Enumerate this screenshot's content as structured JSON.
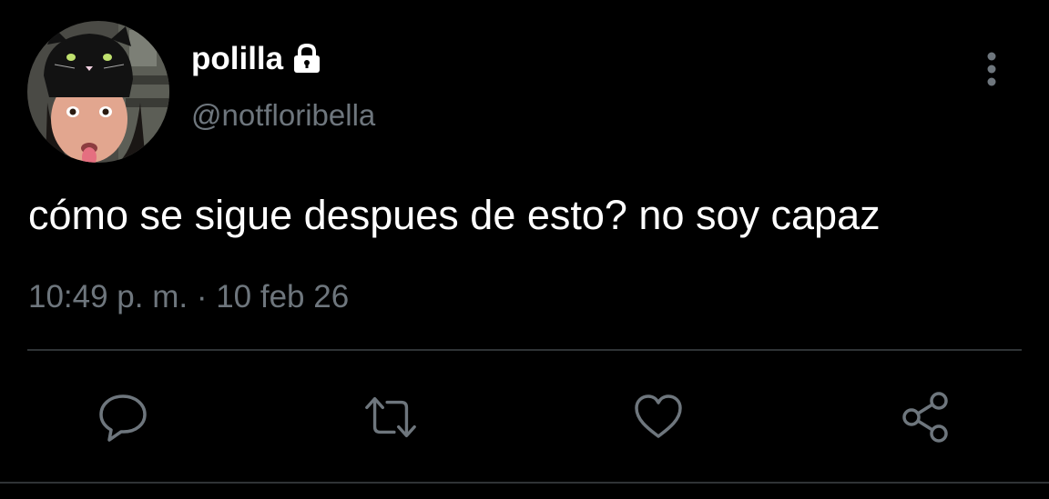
{
  "user": {
    "display_name": "polilla",
    "handle": "@notfloribella",
    "protected": true
  },
  "tweet": {
    "text": "cómo se sigue despues de esto? no soy capaz",
    "timestamp": "10:49 p. m. · 10 feb 26"
  },
  "actions": [
    {
      "name": "reply",
      "icon": "comment-icon"
    },
    {
      "name": "retweet",
      "icon": "retweet-icon"
    },
    {
      "name": "like",
      "icon": "heart-icon"
    },
    {
      "name": "share",
      "icon": "share-icon"
    }
  ],
  "colors": {
    "background": "#000000",
    "primary_text": "#ffffff",
    "secondary_text": "#6e767d",
    "icon": "#6e767d",
    "divider": "#2f3336"
  }
}
